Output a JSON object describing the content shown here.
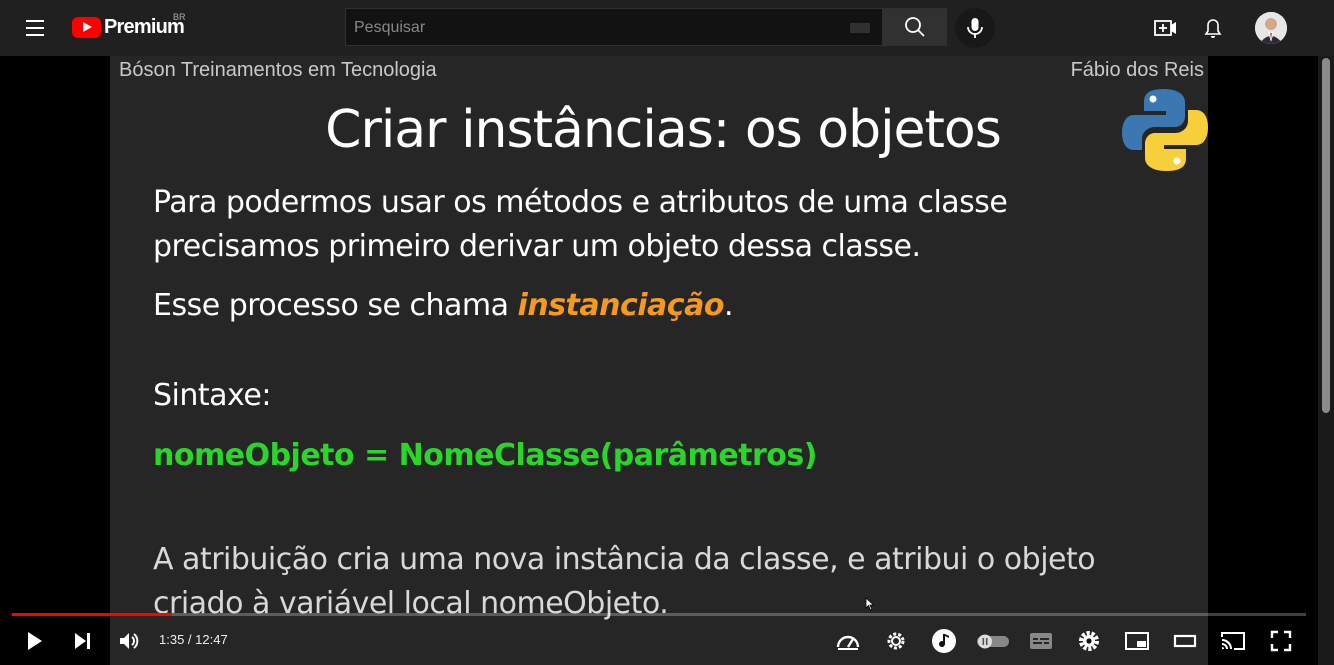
{
  "header": {
    "logo_text": "Premium",
    "region": "BR",
    "search_placeholder": "Pesquisar"
  },
  "slide": {
    "brand": "Bóson Treinamentos em Tecnologia",
    "author": "Fábio dos Reis",
    "title": "Criar instâncias: os objetos",
    "para1_line1": "Para podermos usar os métodos e atributos de uma classe",
    "para1_line2": "precisamos primeiro derivar um objeto dessa classe.",
    "para2_prefix": "Esse processo se chama ",
    "para2_highlight": "instanciação",
    "para2_suffix": ".",
    "syntax_label": "Sintaxe:",
    "code": "nomeObjeto = NomeClasse(parâmetros)",
    "para3_line1": "A atribuição cria uma nova instância da classe, e atribui o objeto",
    "para3_line2": "criado à variável local nomeObjeto."
  },
  "player": {
    "time": "1:35 / 12:47",
    "progress_percent": 12.4,
    "icons": [
      "play-icon",
      "next-icon",
      "volume-icon",
      "speed-icon",
      "settings-gear-alt-icon",
      "music-icon",
      "autoplay-toggle-icon",
      "subtitles-icon",
      "settings-icon",
      "miniplayer-icon",
      "theater-icon",
      "cast-icon",
      "fullscreen-icon"
    ]
  },
  "colors": {
    "brand_red": "#ff0000",
    "highlight_orange": "#f59a1d",
    "code_green": "#2bd62b"
  }
}
